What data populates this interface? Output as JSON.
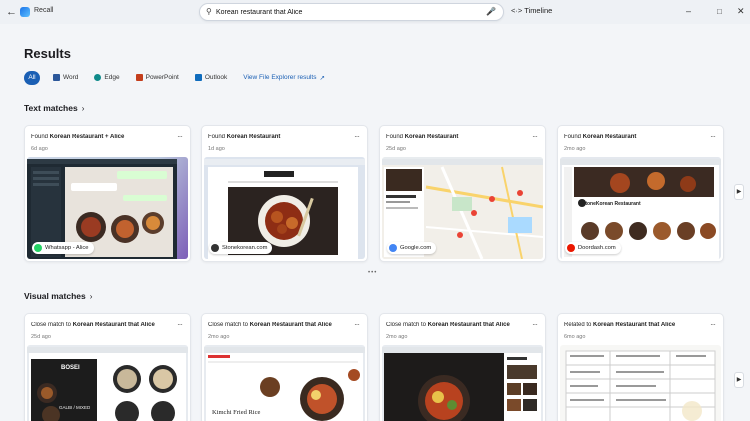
{
  "titlebar": {
    "app_name": "Recall",
    "timeline_label": "Timeline"
  },
  "search": {
    "query": "Korean restaurant that Alice"
  },
  "results": {
    "heading": "Results",
    "filters": [
      {
        "label": "All",
        "color": "#1a5fb4"
      },
      {
        "label": "Word",
        "color": "#2b579a"
      },
      {
        "label": "Edge",
        "color": "#0f8a8a"
      },
      {
        "label": "PowerPoint",
        "color": "#c43e1c"
      },
      {
        "label": "Outlook",
        "color": "#0f6cbd"
      }
    ],
    "explorer_link": "View File Explorer results"
  },
  "text_matches": {
    "heading": "Text matches",
    "cards": [
      {
        "prefix": "Found ",
        "bold": "Korean Restaurant + Alice",
        "age": "6d ago",
        "source": "Whatsapp - Alice",
        "source_color": "#25d366"
      },
      {
        "prefix": "Found ",
        "bold": "Korean Restaurant",
        "age": "1d ago",
        "source": "Stonekorean.com",
        "source_color": "#333333"
      },
      {
        "prefix": "Found ",
        "bold": "Korean Restaurant",
        "age": "25d ago",
        "source": "Google.com",
        "source_color": "#4285f4"
      },
      {
        "prefix": "Found ",
        "bold": "Korean Restaurant",
        "age": "2mo ago",
        "source": "Doordash.com",
        "source_color": "#eb1700"
      }
    ]
  },
  "visual_matches": {
    "heading": "Visual matches",
    "cards": [
      {
        "prefix": "Close match to ",
        "bold": "Korean Restaurant that Alice",
        "age": "25d ago"
      },
      {
        "prefix": "Close match to ",
        "bold": "Korean Restaurant that Alice",
        "age": "2mo ago"
      },
      {
        "prefix": "Close match to ",
        "bold": "Korean Restaurant that Alice",
        "age": "2mo ago"
      },
      {
        "prefix": "Related to ",
        "bold": "Korean Restaurant that Alice",
        "age": "6mo ago"
      }
    ],
    "thumb_texts": {
      "menu_sign": "BOSEI",
      "menu_sub": "GALBI / MIXED",
      "kimchi": "Kimchi Fried Rice"
    }
  },
  "thumb_texts": {
    "stone_header": "StoneKorean Restaurant"
  }
}
